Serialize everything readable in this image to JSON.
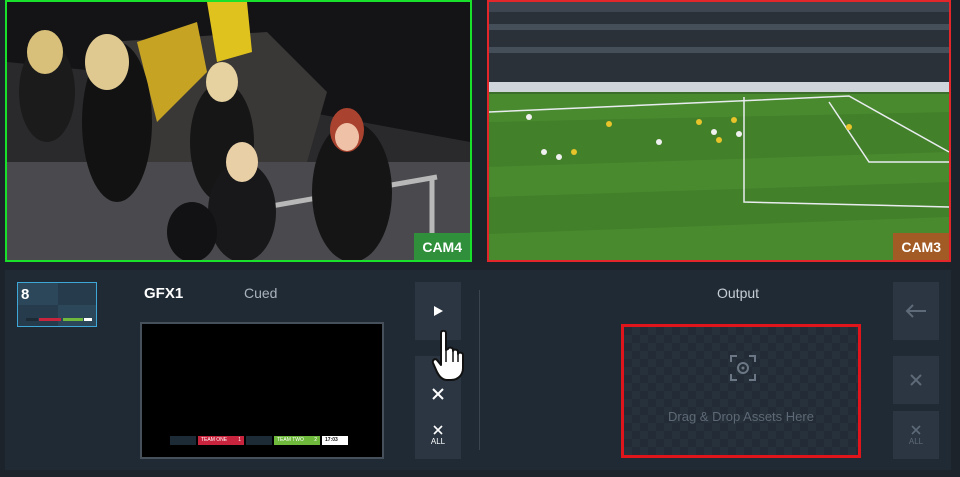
{
  "cameras": {
    "left": {
      "label": "CAM4",
      "border_color": "#19e02a"
    },
    "right": {
      "label": "CAM3",
      "border_color": "#e2262a"
    }
  },
  "cued_item": {
    "thumbnail_number": "8",
    "name": "GFX1",
    "status": "Cued",
    "lower_third": {
      "team_one": "TEAM ONE",
      "team_one_score": "1",
      "team_two": "TEAM TWO",
      "team_two_score": "2",
      "clock": "17:03"
    }
  },
  "controls": {
    "play_icon": "play-icon",
    "clear_icon": "close-icon",
    "clear_all_label": "ALL"
  },
  "output": {
    "label": "Output",
    "drop_text": "Drag & Drop Assets Here",
    "highlight_color": "#e0151b",
    "back_icon": "arrow-left-icon",
    "clear_all_label": "ALL"
  }
}
